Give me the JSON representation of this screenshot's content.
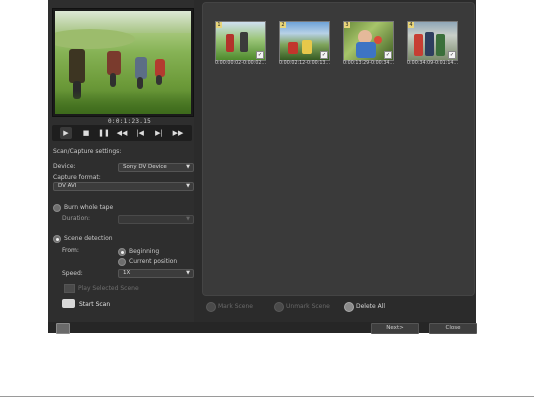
{
  "player": {
    "timecode": "0:0:1:23.15",
    "play_icon": "play-icon",
    "stop_icon": "stop-icon",
    "pause_icon": "pause-icon",
    "rewind_icon": "rewind-icon",
    "prev_icon": "previous-icon",
    "next_icon": "next-icon",
    "ffwd_icon": "fast-forward-icon"
  },
  "settings": {
    "heading": "Scan/Capture settings:",
    "device_label": "Device:",
    "device_value": "Sony DV Device",
    "format_label": "Capture format:",
    "format_value": "DV AVI",
    "burn_label": "Burn whole tape",
    "duration_label": "Duration:",
    "duration_value": "",
    "scene_label": "Scene detection",
    "from_label": "From:",
    "from_beginning": "Beginning",
    "from_current": "Current position",
    "speed_label": "Speed:",
    "speed_value": "1X",
    "play_selected": "Play Selected Scene",
    "start_scan": "Start Scan"
  },
  "scenes": [
    {
      "num": "1",
      "time": "0:00:00:02-0:00:02..."
    },
    {
      "num": "2",
      "time": "0:00:02:12-0:00:13..."
    },
    {
      "num": "3",
      "time": "0:00:13:29-0:00:34..."
    },
    {
      "num": "4",
      "time": "0:00:34:09-0:01:14..."
    }
  ],
  "scene_actions": {
    "mark": "Mark Scene",
    "unmark": "Unmark Scene",
    "delete_all": "Delete All"
  },
  "footer": {
    "next": "Next>",
    "close": "Close"
  },
  "colors": {
    "window_bg": "#2b2b2b",
    "panel_bg": "#3a3a3a",
    "accent_number": "#e8d57a"
  }
}
